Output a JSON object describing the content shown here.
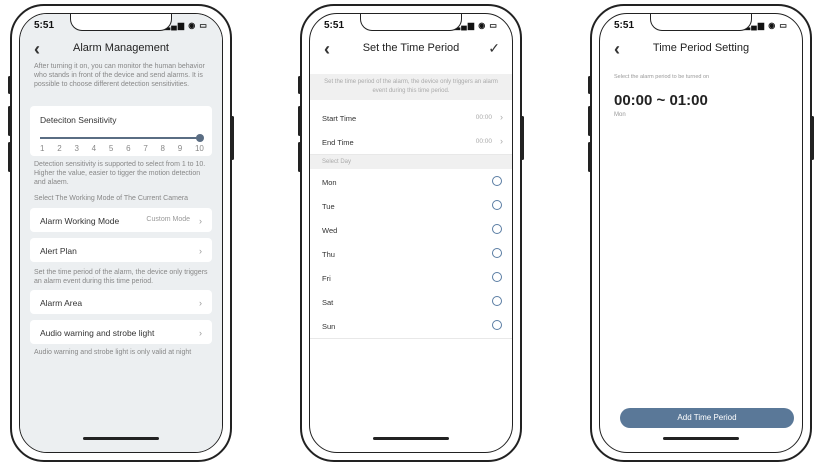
{
  "status_time": "5:51",
  "screen1": {
    "title": "Alarm Management",
    "intro": "After turning it on, you can monitor the human behavior who stands in front of the device and send alarms. It is possible to choose different detection sensitivities.",
    "sensitivity_label": "Deteciton Sensitivity",
    "sensitivity_value": 10,
    "sensitivity_ticks": [
      "1",
      "2",
      "3",
      "4",
      "5",
      "6",
      "7",
      "8",
      "9",
      "10"
    ],
    "sensitivity_note": "Detection sensitivity is supported to select from 1 to 10. Higher the value, easier to tigger the motion detection and alaem.",
    "mode_section": "Select The Working Mode of The Current Camera",
    "working_mode_label": "Alarm Working Mode",
    "working_mode_value": "Custom Mode",
    "alert_plan_label": "Alert Plan",
    "alert_plan_note": "Set the time period of the alarm, the device only triggers an alarm event during this time period.",
    "alarm_area_label": "Alarm Area",
    "audio_label": "Audio warning and strobe light",
    "audio_note": "Audio warning and strobe light is only valid at night"
  },
  "screen2": {
    "title": "Set the Time Period",
    "intro": "Set the time period of the alarm, the device only triggers an alarm event during this time period.",
    "start_label": "Start Time",
    "start_value": "00:00",
    "end_label": "End Time",
    "end_value": "00:00",
    "select_day": "Select Day",
    "days": [
      "Mon",
      "Tue",
      "Wed",
      "Thu",
      "Fri",
      "Sat",
      "Sun"
    ]
  },
  "screen3": {
    "title": "Time Period Setting",
    "hint": "Select the alarm period to be turned on",
    "period": "00:00 ~ 01:00",
    "day": "Mon",
    "add_button": "Add Time Period",
    "accent": "#5a7898"
  }
}
